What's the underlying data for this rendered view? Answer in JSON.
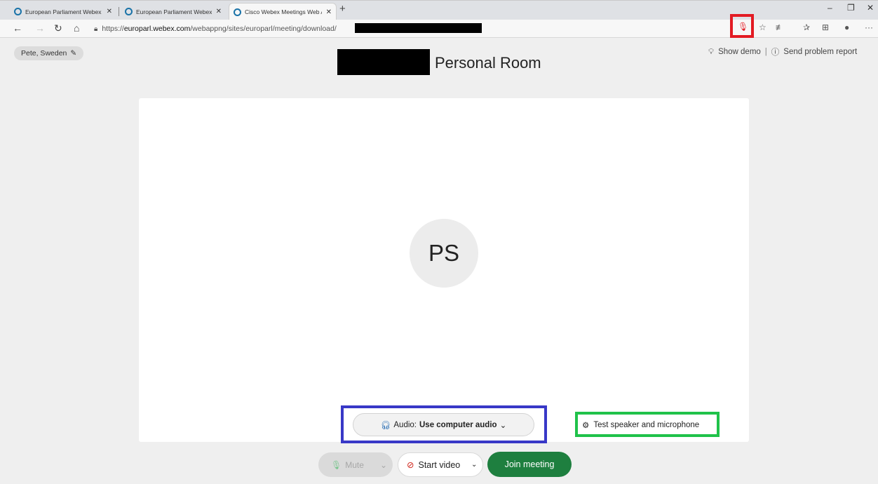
{
  "browser": {
    "tabs": [
      {
        "title": "European Parliament Webex - Pe",
        "active": false
      },
      {
        "title": "European Parliament Webex - Pe",
        "active": false
      },
      {
        "title": "Cisco Webex Meetings Web App",
        "active": true
      }
    ],
    "new_tab": "+",
    "url_scheme": "https://",
    "url_host": "europarl.webex.com",
    "url_path": "/webappng/sites/europarl/meeting/download/",
    "window": {
      "minimize": "–",
      "restore": "❐",
      "close": "✕"
    }
  },
  "page": {
    "user_name": "Pete, Sweden",
    "room_title": "Personal Room",
    "show_demo": "Show demo",
    "separator": "|",
    "send_report": "Send problem report",
    "avatar_initials": "PS",
    "audio_label": "Audio:",
    "audio_value": "Use computer audio",
    "test_speaker": "Test speaker and microphone",
    "mute_label": "Mute",
    "start_video_label": "Start video",
    "join_label": "Join meeting"
  },
  "colors": {
    "join": "#1e7f3f",
    "highlight_red": "#e31b23",
    "highlight_blue": "#3838c7",
    "highlight_green": "#20c24a"
  }
}
